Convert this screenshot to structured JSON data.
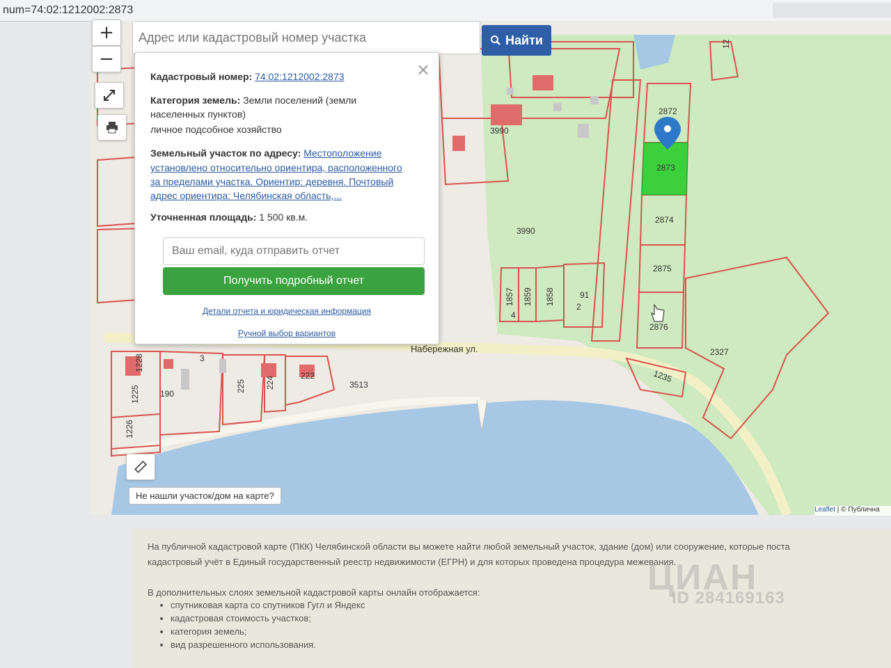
{
  "url_bar": {
    "text": "num=74:02:1212002:2873"
  },
  "search": {
    "placeholder": "Адрес или кадастровый номер участка",
    "button_label": "Найти"
  },
  "controls": {
    "zoom_in": "+",
    "zoom_out": "−"
  },
  "popup": {
    "cad_label": "Кадастровый номер:",
    "cad_value": "74:02:1212002:2873",
    "category_label": "Категория земель:",
    "category_line1": "Земли поселений (земли",
    "category_line2": "населенных пунктов)",
    "category_line3": "личное подсобное хозяйство",
    "address_label": "Земельный участок по адресу:",
    "address_part1": "Местоположение",
    "address_line2": "установлено относительно ориентира, расположенного",
    "address_line3": "за пределами участка. Ориентир: деревня. Почтовый",
    "address_line4": "адрес ориентира: Челябинская область,...",
    "area_label": "Уточненная площадь:",
    "area_value": "1 500 кв.м.",
    "email_placeholder": "Ваш email, куда отправить отчет",
    "report_button": "Получить подробный отчет",
    "details_link": "Детали отчета и юридическая информация",
    "manual_link": "Ручной выбор вариантов"
  },
  "map": {
    "street_label": "Набережная ул.",
    "parcels": [
      "3990",
      "3990",
      "2872",
      "2873",
      "2874",
      "2875",
      "2876",
      "2327",
      "1235",
      "1857",
      "1859",
      "1858",
      "91",
      "2",
      "4",
      "3",
      "1228",
      "1225",
      "190",
      "225",
      "224",
      "222",
      "3513",
      "1226",
      "12"
    ],
    "selected_parcel": "2873",
    "not_found_button": "Не нашли участок/дом на карте?",
    "attribution_link": "Leaflet",
    "attribution_text": " | © Публична",
    "colors": {
      "selected": "#3cd13c",
      "water": "#a6c8e4",
      "green_area": "#cfe9c0",
      "boundary": "#d9534f"
    }
  },
  "lower": {
    "p1_line1": "На публичной кадастровой карте (ПКК) Челябинской области вы можете найти любой земельный участок, здание (дом) или сооружение, которые поста",
    "p1_line2": "кадастровый учёт в Единый государственный реестр недвижимости (ЕГРН) и для которых проведена процедура межевания.",
    "p2": "В дополнительных слоях земельной кадастровой карты онлайн отображается:",
    "list": [
      "спутниковая карта со спутников Гугл и Яндекс",
      "кадастровая стоимость участков;",
      "категория земель;",
      "вид разрешенного использования."
    ]
  },
  "watermark": {
    "brand": "ЦИАН",
    "id": "ID 284169163"
  }
}
